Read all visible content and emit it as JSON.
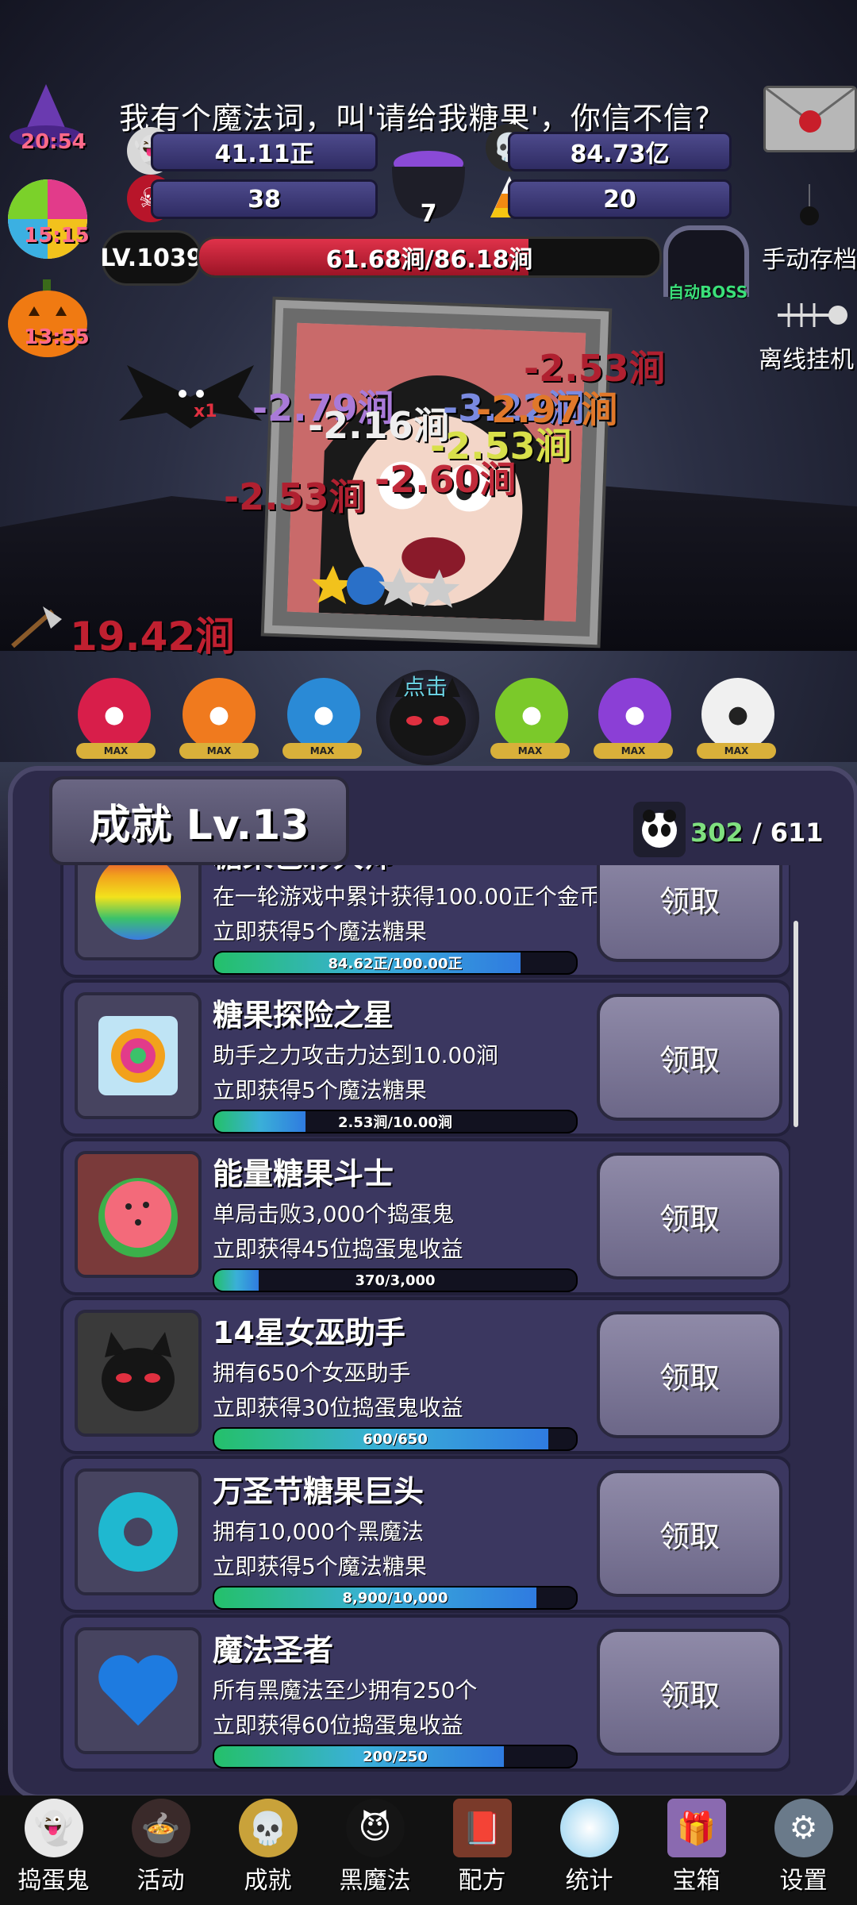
{
  "dialog": "我有个魔法词，叫'请给我糖果'，你信不信?",
  "timers": {
    "hat": "20:54",
    "lollipop": "15:15",
    "pumpkin": "13:55"
  },
  "stats": {
    "ghost_coins": "41.11正",
    "potion": "84.73亿",
    "skull_candy": "38",
    "cauldron": "7",
    "candy_corn": "20"
  },
  "level": "LV.1039",
  "boss_hp": {
    "text": "61.68涧/86.18涧",
    "fraction": 0.716
  },
  "auto_boss": "自动BOSS",
  "manual_save": "手动存档",
  "offline": "离线挂机",
  "damage_numbers": [
    "-2.53涧",
    "-2.79涧",
    "-2.16涧",
    "-3.22涧",
    "-2.97涧",
    "-2.53涧",
    "-2.60涧",
    "-2.53涧"
  ],
  "big_damage": "19.42涧",
  "bat_multiplier": "x1",
  "click_label": "点击",
  "candies": {
    "max": "MAX",
    "colors": [
      "#d81e4a",
      "#f07a1e",
      "#2a8ad6",
      "#7bc92a",
      "#8b3fd6",
      "#f0f0f0"
    ]
  },
  "panel": {
    "title": "成就 Lv.13",
    "done": "302",
    "sep": "/",
    "total": "611"
  },
  "achievements": [
    {
      "title": "糖果色彩大师",
      "desc": "在一轮游戏中累计获得100.00正个金币",
      "reward": "立即获得5个魔法糖果",
      "progress": "84.62正/100.00正",
      "fraction": 0.846,
      "button": "领取",
      "icon": "rainbow-candy-icon"
    },
    {
      "title": "糖果探险之星",
      "desc": "助手之力攻击力达到10.00涧",
      "reward": "立即获得5个魔法糖果",
      "progress": "2.53涧/10.00涧",
      "fraction": 0.253,
      "button": "领取",
      "icon": "wrapped-candy-icon"
    },
    {
      "title": "能量糖果斗士",
      "desc": "单局击败3,000个捣蛋鬼",
      "reward": "立即获得45位捣蛋鬼收益",
      "progress": "370/3,000",
      "fraction": 0.123,
      "button": "领取",
      "icon": "watermelon-candy-icon"
    },
    {
      "title": "14星女巫助手",
      "desc": "拥有650个女巫助手",
      "reward": "立即获得30位捣蛋鬼收益",
      "progress": "600/650",
      "fraction": 0.923,
      "button": "领取",
      "icon": "black-cat-icon"
    },
    {
      "title": "万圣节糖果巨头",
      "desc": "拥有10,000个黑魔法",
      "reward": "立即获得5个魔法糖果",
      "progress": "8,900/10,000",
      "fraction": 0.89,
      "button": "领取",
      "icon": "donut-candy-icon"
    },
    {
      "title": "魔法圣者",
      "desc": "所有黑魔法至少拥有250个",
      "reward": "立即获得60位捣蛋鬼收益",
      "progress": "200/250",
      "fraction": 0.8,
      "button": "领取",
      "icon": "heart-candy-icon"
    }
  ],
  "nav": [
    {
      "label": "捣蛋鬼",
      "icon": "ghost-icon"
    },
    {
      "label": "活动",
      "icon": "cauldron-icon"
    },
    {
      "label": "成就",
      "icon": "skull-trophy-icon"
    },
    {
      "label": "黑魔法",
      "icon": "devil-icon"
    },
    {
      "label": "配方",
      "icon": "recipe-book-icon"
    },
    {
      "label": "统计",
      "icon": "crystal-ball-icon"
    },
    {
      "label": "宝箱",
      "icon": "gift-box-icon"
    },
    {
      "label": "设置",
      "icon": "gear-icon"
    }
  ]
}
